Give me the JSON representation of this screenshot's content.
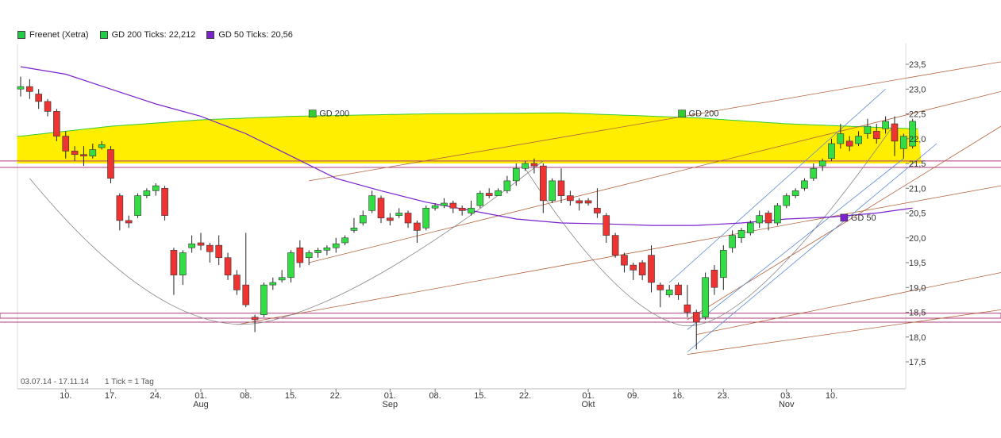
{
  "legend": [
    {
      "label": "Freenet (Xetra)",
      "color": "#22cc44"
    },
    {
      "label": "GD 200 Ticks: 22,212",
      "color": "#22cc44"
    },
    {
      "label": "GD 50 Ticks: 20,56",
      "color": "#7a22cc"
    }
  ],
  "footer": {
    "date_range": "03.07.14 - 17.11.14",
    "tick_info": "1 Tick = 1 Tag"
  },
  "colors": {
    "up": "#33dd44",
    "down": "#ee3333",
    "gd200_fill": "#ffee00",
    "gd200_line": "#33cc33",
    "gd50_line": "#7a22cc",
    "channel": "#b5643c",
    "fan": "#5a8ad6",
    "arc": "#888888",
    "hline": "#b03a7a"
  },
  "chart_data": {
    "type": "candlestick",
    "title": "Freenet (Xetra)",
    "ylim": [
      17.3,
      23.7
    ],
    "y_ticks": [
      "23,5",
      "23,0",
      "22,5",
      "22,0",
      "21,5",
      "21,0",
      "20,5",
      "20,0",
      "19,5",
      "19,0",
      "18,5",
      "18,0",
      "17,5"
    ],
    "y_tick_values": [
      23.5,
      23.0,
      22.5,
      22.0,
      21.5,
      21.0,
      20.5,
      20.0,
      19.5,
      19.0,
      18.5,
      18.0,
      17.5
    ],
    "x_ticks": [
      {
        "label": "10.",
        "i": 5
      },
      {
        "label": "17.",
        "i": 10
      },
      {
        "label": "24.",
        "i": 15
      },
      {
        "label": "01.",
        "sub": "Aug",
        "i": 20
      },
      {
        "label": "08.",
        "i": 25
      },
      {
        "label": "15.",
        "i": 30
      },
      {
        "label": "22.",
        "i": 35
      },
      {
        "label": "01.",
        "sub": "Sep",
        "i": 41
      },
      {
        "label": "08.",
        "i": 46
      },
      {
        "label": "15.",
        "i": 51
      },
      {
        "label": "22.",
        "i": 56
      },
      {
        "label": "01.",
        "sub": "Okt",
        "i": 63
      },
      {
        "label": "09.",
        "i": 68
      },
      {
        "label": "16.",
        "i": 73
      },
      {
        "label": "23.",
        "i": 78
      },
      {
        "label": "03.",
        "sub": "Nov",
        "i": 85
      },
      {
        "label": "10.",
        "i": 90
      }
    ],
    "series_labels": [
      {
        "text": "GD 200",
        "i": 32,
        "y": 22.45,
        "color": "#33cc33"
      },
      {
        "text": "GD 200",
        "i": 73,
        "y": 22.45,
        "color": "#33cc33"
      },
      {
        "text": "GD 50",
        "i": 91,
        "y": 20.35,
        "color": "#7a22cc"
      }
    ],
    "candles": [
      [
        0,
        23.0,
        23.05,
        23.25,
        22.85
      ],
      [
        1,
        23.05,
        22.95,
        23.2,
        22.8
      ],
      [
        2,
        22.9,
        22.75,
        23.0,
        22.6
      ],
      [
        3,
        22.75,
        22.55,
        22.8,
        22.45
      ],
      [
        4,
        22.55,
        22.05,
        22.6,
        21.95
      ],
      [
        5,
        22.05,
        21.75,
        22.15,
        21.6
      ],
      [
        6,
        21.75,
        21.68,
        21.85,
        21.55
      ],
      [
        7,
        21.68,
        21.65,
        21.85,
        21.45
      ],
      [
        8,
        21.65,
        21.78,
        21.9,
        21.6
      ],
      [
        9,
        21.82,
        21.88,
        21.95,
        21.78
      ],
      [
        10,
        21.78,
        21.2,
        21.85,
        21.1
      ],
      [
        11,
        20.85,
        20.35,
        20.9,
        20.15
      ],
      [
        12,
        20.35,
        20.3,
        20.45,
        20.2
      ],
      [
        13,
        20.45,
        20.85,
        20.9,
        20.4
      ],
      [
        14,
        20.85,
        20.95,
        21.0,
        20.8
      ],
      [
        15,
        20.95,
        21.05,
        21.1,
        20.85
      ],
      [
        16,
        21.0,
        20.45,
        21.05,
        20.35
      ],
      [
        17,
        19.75,
        19.25,
        19.8,
        18.85
      ],
      [
        18,
        19.25,
        19.7,
        19.75,
        19.05
      ],
      [
        19,
        19.8,
        19.88,
        20.05,
        19.7
      ],
      [
        20,
        19.9,
        19.85,
        20.1,
        19.75
      ],
      [
        21,
        19.85,
        19.72,
        19.9,
        19.5
      ],
      [
        22,
        19.85,
        19.6,
        20.05,
        19.45
      ],
      [
        23,
        19.6,
        19.25,
        19.7,
        19.15
      ],
      [
        24,
        19.25,
        18.95,
        19.35,
        18.85
      ],
      [
        25,
        19.05,
        18.65,
        20.1,
        18.6
      ],
      [
        26,
        18.4,
        18.35,
        18.45,
        18.1
      ],
      [
        27,
        18.45,
        19.05,
        19.1,
        18.4
      ],
      [
        28,
        19.05,
        19.1,
        19.2,
        18.95
      ],
      [
        29,
        19.15,
        19.2,
        19.35,
        19.1
      ],
      [
        30,
        19.2,
        19.7,
        19.75,
        19.1
      ],
      [
        31,
        19.8,
        19.5,
        19.95,
        19.4
      ],
      [
        32,
        19.6,
        19.7,
        19.75,
        19.45
      ],
      [
        33,
        19.7,
        19.75,
        19.8,
        19.6
      ],
      [
        34,
        19.75,
        19.8,
        19.85,
        19.65
      ],
      [
        35,
        19.8,
        19.88,
        20.0,
        19.7
      ],
      [
        36,
        19.9,
        20.0,
        20.05,
        19.85
      ],
      [
        37,
        20.15,
        20.2,
        20.4,
        20.1
      ],
      [
        38,
        20.3,
        20.45,
        20.55,
        20.25
      ],
      [
        39,
        20.55,
        20.85,
        20.95,
        20.5
      ],
      [
        40,
        20.8,
        20.4,
        20.85,
        20.3
      ],
      [
        41,
        20.4,
        20.35,
        20.5,
        20.25
      ],
      [
        42,
        20.45,
        20.5,
        20.6,
        20.4
      ],
      [
        43,
        20.5,
        20.3,
        20.55,
        20.2
      ],
      [
        44,
        20.3,
        20.15,
        20.35,
        19.9
      ],
      [
        45,
        20.2,
        20.6,
        20.65,
        20.15
      ],
      [
        46,
        20.6,
        20.65,
        20.7,
        20.55
      ],
      [
        47,
        20.65,
        20.7,
        20.8,
        20.6
      ],
      [
        48,
        20.7,
        20.6,
        20.75,
        20.5
      ],
      [
        49,
        20.6,
        20.55,
        20.65,
        20.45
      ],
      [
        50,
        20.5,
        20.6,
        20.75,
        20.45
      ],
      [
        51,
        20.65,
        20.9,
        20.95,
        20.6
      ],
      [
        52,
        20.9,
        20.85,
        21.0,
        20.8
      ],
      [
        53,
        20.85,
        20.95,
        21.0,
        20.85
      ],
      [
        54,
        20.95,
        21.15,
        21.25,
        20.9
      ],
      [
        55,
        21.15,
        21.4,
        21.5,
        21.05
      ],
      [
        56,
        21.4,
        21.5,
        21.55,
        21.35
      ],
      [
        57,
        21.5,
        21.45,
        21.6,
        21.3
      ],
      [
        58,
        21.45,
        20.75,
        21.5,
        20.5
      ],
      [
        59,
        20.75,
        21.15,
        21.2,
        20.7
      ],
      [
        60,
        21.15,
        20.85,
        21.4,
        20.7
      ],
      [
        61,
        20.85,
        20.75,
        20.95,
        20.65
      ],
      [
        62,
        20.75,
        20.7,
        20.8,
        20.55
      ],
      [
        63,
        20.75,
        20.7,
        20.8,
        20.65
      ],
      [
        64,
        20.6,
        20.5,
        21.0,
        20.4
      ],
      [
        65,
        20.45,
        20.05,
        20.5,
        19.9
      ],
      [
        66,
        20.05,
        19.65,
        20.1,
        19.6
      ],
      [
        67,
        19.65,
        19.45,
        19.7,
        19.3
      ],
      [
        68,
        19.45,
        19.35,
        19.5,
        19.15
      ],
      [
        69,
        19.5,
        19.25,
        19.55,
        19.15
      ],
      [
        70,
        19.65,
        19.1,
        19.85,
        18.9
      ],
      [
        71,
        19.05,
        18.95,
        19.1,
        18.6
      ],
      [
        72,
        18.85,
        18.95,
        19.05,
        18.8
      ],
      [
        73,
        19.05,
        18.85,
        19.1,
        18.75
      ],
      [
        74,
        18.65,
        18.5,
        19.05,
        18.4
      ],
      [
        75,
        18.5,
        18.3,
        18.55,
        17.75
      ],
      [
        76,
        18.4,
        19.2,
        19.3,
        18.35
      ],
      [
        77,
        19.35,
        19.0,
        19.45,
        18.85
      ],
      [
        78,
        19.2,
        19.75,
        19.85,
        18.95
      ],
      [
        79,
        19.8,
        20.05,
        20.15,
        19.7
      ],
      [
        80,
        20.0,
        20.15,
        20.2,
        19.9
      ],
      [
        81,
        20.1,
        20.3,
        20.35,
        20.05
      ],
      [
        82,
        20.3,
        20.45,
        20.55,
        20.2
      ],
      [
        83,
        20.5,
        20.3,
        20.55,
        20.15
      ],
      [
        84,
        20.3,
        20.65,
        20.7,
        20.25
      ],
      [
        85,
        20.65,
        20.85,
        20.9,
        20.6
      ],
      [
        86,
        20.85,
        20.95,
        21.0,
        20.8
      ],
      [
        87,
        21.0,
        21.15,
        21.2,
        20.95
      ],
      [
        88,
        21.2,
        21.4,
        21.5,
        21.15
      ],
      [
        89,
        21.45,
        21.55,
        21.6,
        21.35
      ],
      [
        90,
        21.6,
        21.9,
        22.0,
        21.55
      ],
      [
        91,
        21.9,
        22.1,
        22.3,
        21.8
      ],
      [
        92,
        21.95,
        21.85,
        22.05,
        21.75
      ],
      [
        93,
        21.9,
        22.05,
        22.15,
        21.85
      ],
      [
        94,
        22.1,
        22.25,
        22.4,
        22.0
      ],
      [
        95,
        22.15,
        22.0,
        22.3,
        21.9
      ],
      [
        96,
        22.2,
        22.35,
        22.45,
        22.1
      ],
      [
        97,
        22.3,
        21.95,
        22.45,
        21.65
      ],
      [
        98,
        21.8,
        22.05,
        22.1,
        21.6
      ],
      [
        99,
        21.85,
        22.35,
        22.4,
        21.8
      ]
    ],
    "gd200": [
      [
        0,
        22.05
      ],
      [
        10,
        22.25
      ],
      [
        20,
        22.38
      ],
      [
        30,
        22.45
      ],
      [
        45,
        22.5
      ],
      [
        60,
        22.52
      ],
      [
        75,
        22.42
      ],
      [
        85,
        22.3
      ],
      [
        99,
        22.2
      ]
    ],
    "gd50": [
      [
        0,
        23.45
      ],
      [
        5,
        23.3
      ],
      [
        10,
        23.0
      ],
      [
        15,
        22.7
      ],
      [
        20,
        22.45
      ],
      [
        25,
        22.1
      ],
      [
        30,
        21.65
      ],
      [
        35,
        21.2
      ],
      [
        40,
        20.95
      ],
      [
        45,
        20.72
      ],
      [
        50,
        20.55
      ],
      [
        55,
        20.38
      ],
      [
        60,
        20.3
      ],
      [
        65,
        20.28
      ],
      [
        70,
        20.25
      ],
      [
        75,
        20.25
      ],
      [
        80,
        20.3
      ],
      [
        85,
        20.38
      ],
      [
        90,
        20.42
      ],
      [
        95,
        20.5
      ],
      [
        99,
        20.6
      ]
    ]
  }
}
